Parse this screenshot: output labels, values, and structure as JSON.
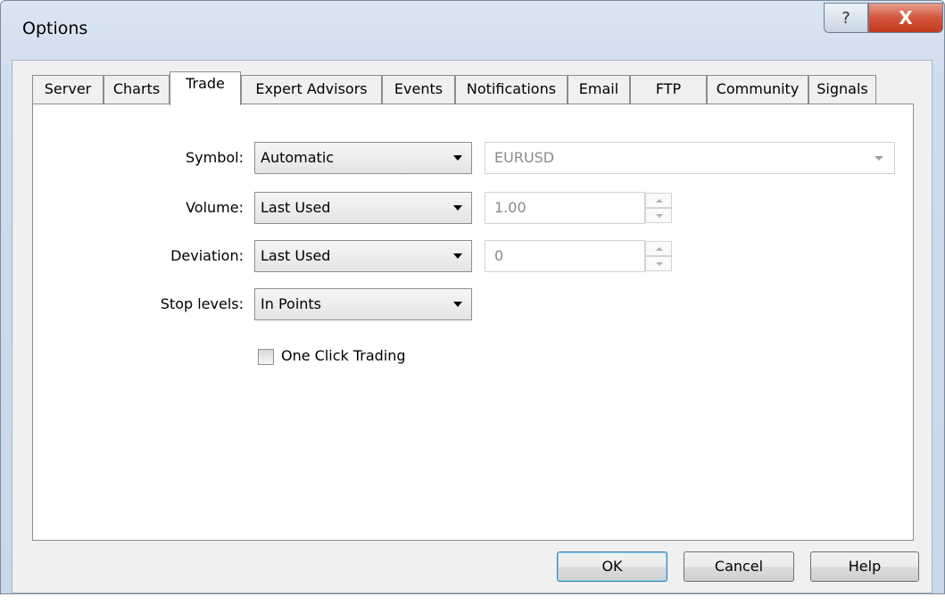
{
  "window": {
    "title": "Options",
    "help_glyph": "?",
    "close_glyph": "X"
  },
  "tabs": [
    {
      "label": "Server"
    },
    {
      "label": "Charts"
    },
    {
      "label": "Trade"
    },
    {
      "label": "Expert Advisors"
    },
    {
      "label": "Events"
    },
    {
      "label": "Notifications"
    },
    {
      "label": "Email"
    },
    {
      "label": "FTP"
    },
    {
      "label": "Community"
    },
    {
      "label": "Signals"
    }
  ],
  "active_tab": "Trade",
  "trade": {
    "symbol": {
      "label": "Symbol:",
      "mode": "Automatic",
      "value": "EURUSD"
    },
    "volume": {
      "label": "Volume:",
      "mode": "Last Used",
      "value": "1.00"
    },
    "deviation": {
      "label": "Deviation:",
      "mode": "Last Used",
      "value": "0"
    },
    "stop_levels": {
      "label": "Stop levels:",
      "mode": "In Points"
    },
    "one_click": {
      "label": "One Click Trading",
      "checked": false
    }
  },
  "buttons": {
    "ok": "OK",
    "cancel": "Cancel",
    "help": "Help"
  },
  "colors": {
    "close_button": "#c23a20",
    "default_button_border": "#3c7fb1"
  }
}
